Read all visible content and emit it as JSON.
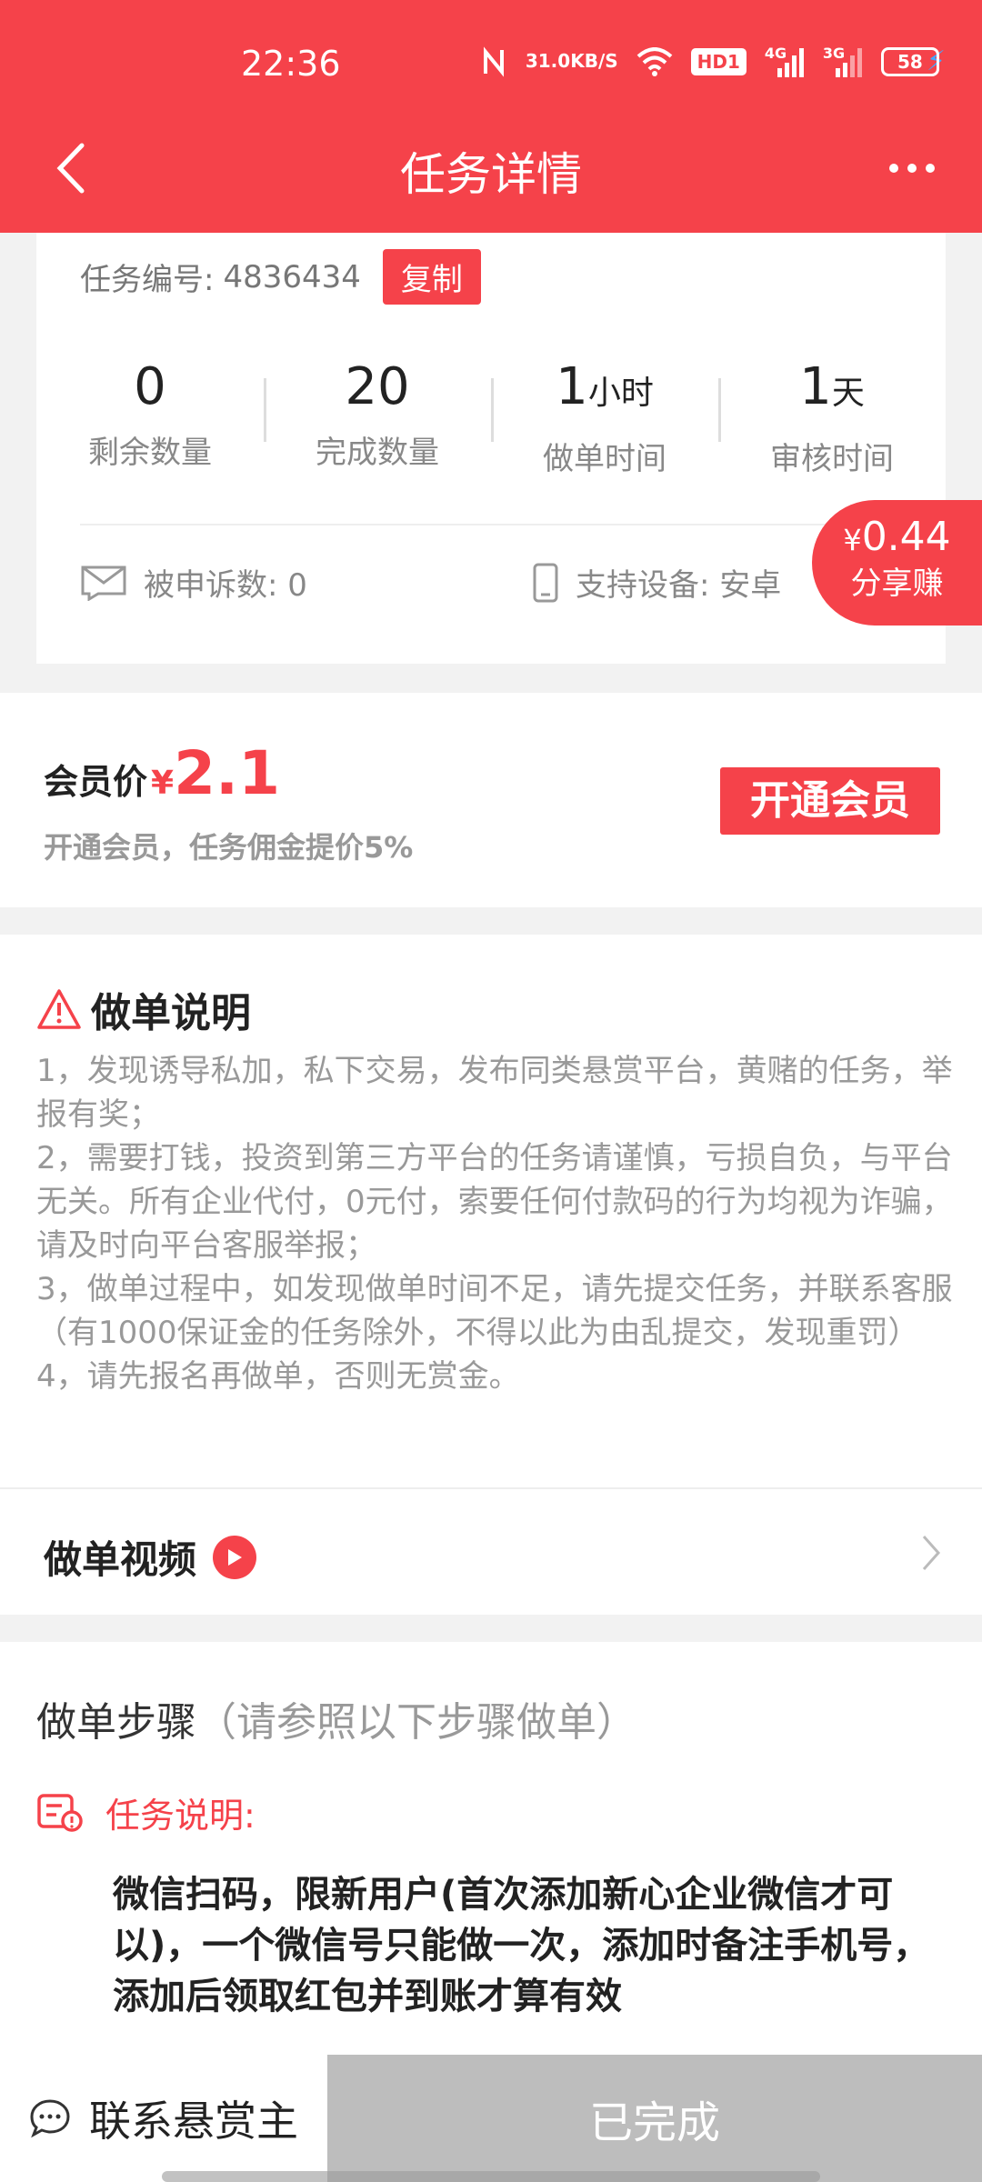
{
  "status_bar": {
    "time": "22:36",
    "net_speed_value": "31.0",
    "net_speed_unit": "KB/S",
    "hd_label": "HD1",
    "signal1_label": "4G",
    "signal2_label": "3G",
    "battery_level": "58"
  },
  "nav": {
    "title": "任务详情"
  },
  "task": {
    "id_label": "任务编号:",
    "id_value": "4836434",
    "copy_label": "复制",
    "stats": [
      {
        "value": "0",
        "unit": "",
        "label": "剩余数量"
      },
      {
        "value": "20",
        "unit": "",
        "label": "完成数量"
      },
      {
        "value": "1",
        "unit": "小时",
        "label": "做单时间"
      },
      {
        "value": "1",
        "unit": "天",
        "label": "审核时间"
      }
    ],
    "complaints_label": "被申诉数: 0",
    "device_label": "支持设备: 安卓"
  },
  "share": {
    "currency": "¥",
    "amount": "0.44",
    "label": "分享赚"
  },
  "member": {
    "title": "会员价",
    "currency": "¥",
    "price": "2.1",
    "desc": "开通会员，任务佣金提价5%",
    "button": "开通会员"
  },
  "instructions": {
    "title": "做单说明",
    "lines": [
      "1，发现诱导私加，私下交易，发布同类悬赏平台，黄赌的任务，举报有奖；",
      "2，需要打钱，投资到第三方平台的任务请谨慎，亏损自负，与平台无关。所有企业代付，0元付，索要任何付款码的行为均视为诈骗，请及时向平台客服举报；",
      "3，做单过程中，如发现做单时间不足，请先提交任务，并联系客服（有1000保证金的任务除外，不得以此为由乱提交，发现重罚）",
      "4，请先报名再做单，否则无赏金。"
    ]
  },
  "video": {
    "label": "做单视频"
  },
  "steps": {
    "title": "做单步骤",
    "hint": "（请参照以下步骤做单）",
    "task_desc_label": "任务说明:",
    "task_desc_text": "微信扫码，限新用户(首次添加新心企业微信才可以)，一个微信号只能做一次，添加时备注手机号，添加后领取红包并到账才算有效"
  },
  "bottom": {
    "contact": "联系悬赏主",
    "status": "已完成"
  },
  "colors": {
    "accent": "#f5424a",
    "done_bg": "#bdbdbd"
  }
}
